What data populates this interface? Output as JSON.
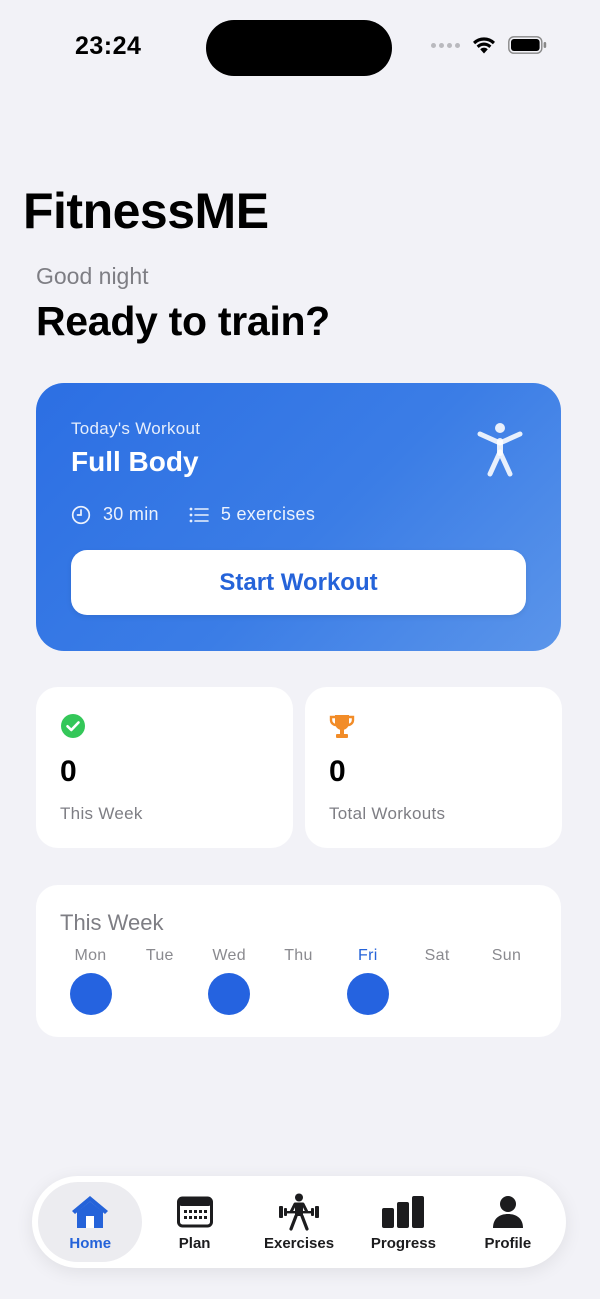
{
  "status_bar": {
    "time": "23:24"
  },
  "header": {
    "app_title": "FitnessME",
    "greeting": "Good night",
    "headline": "Ready to train?"
  },
  "workout_card": {
    "label": "Today's Workout",
    "title": "Full Body",
    "duration": "30 min",
    "exercises": "5 exercises",
    "start_label": "Start Workout"
  },
  "stats": [
    {
      "value": "0",
      "label": "This Week",
      "icon": "checkmark-circle-icon",
      "color": "#34c759"
    },
    {
      "value": "0",
      "label": "Total Workouts",
      "icon": "trophy-icon",
      "color": "#f28c28"
    }
  ],
  "week": {
    "title": "This Week",
    "days": [
      {
        "label": "Mon",
        "done": true,
        "today": false
      },
      {
        "label": "Tue",
        "done": false,
        "today": false
      },
      {
        "label": "Wed",
        "done": true,
        "today": false
      },
      {
        "label": "Thu",
        "done": false,
        "today": false
      },
      {
        "label": "Fri",
        "done": true,
        "today": true
      },
      {
        "label": "Sat",
        "done": false,
        "today": false
      },
      {
        "label": "Sun",
        "done": false,
        "today": false
      }
    ]
  },
  "tab_bar": {
    "tabs": [
      {
        "label": "Home",
        "icon": "house-icon",
        "active": true
      },
      {
        "label": "Plan",
        "icon": "calendar-icon",
        "active": false
      },
      {
        "label": "Exercises",
        "icon": "weightlifter-icon",
        "active": false
      },
      {
        "label": "Progress",
        "icon": "bar-chart-icon",
        "active": false
      },
      {
        "label": "Profile",
        "icon": "person-icon",
        "active": false
      }
    ]
  },
  "colors": {
    "accent": "#2563d9",
    "background": "#f2f2f7",
    "success": "#34c759",
    "trophy": "#f28c28"
  }
}
